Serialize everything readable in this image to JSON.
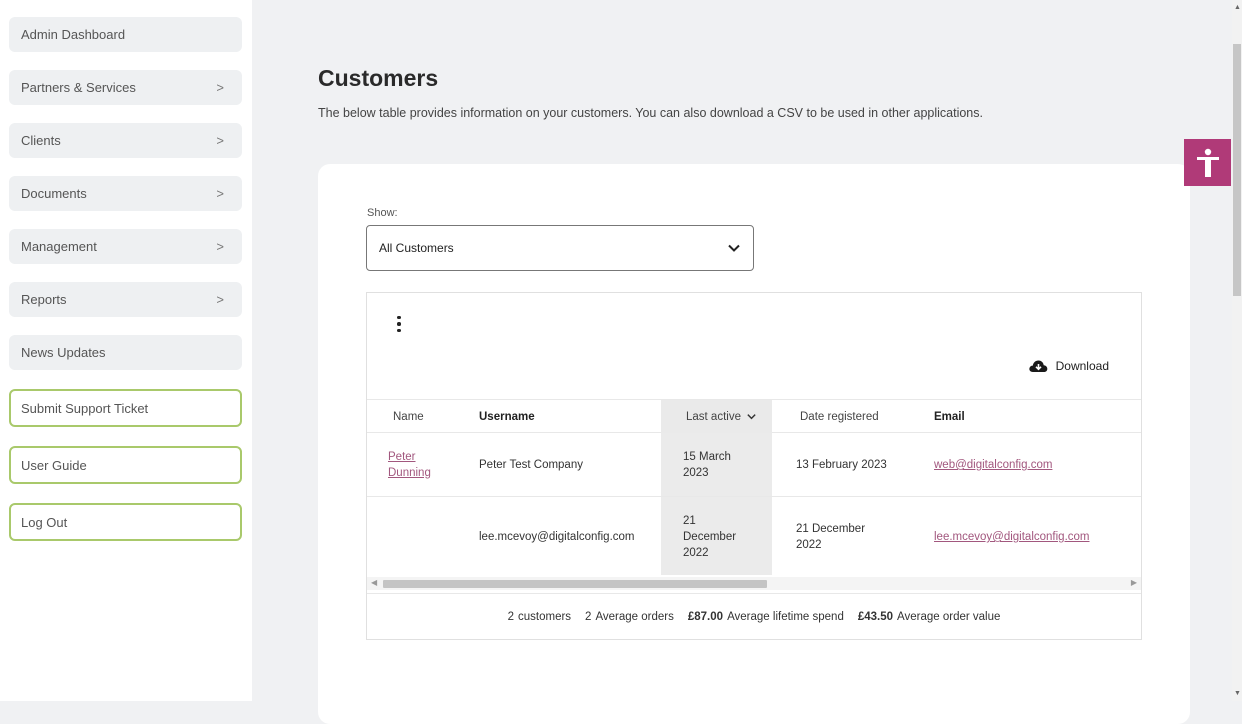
{
  "sidebar": {
    "items": [
      {
        "label": "Admin Dashboard"
      },
      {
        "label": "Partners & Services"
      },
      {
        "label": "Clients"
      },
      {
        "label": "Documents"
      },
      {
        "label": "Management"
      },
      {
        "label": "Reports"
      },
      {
        "label": "News Updates"
      },
      {
        "label": "Submit Support Ticket"
      },
      {
        "label": "User Guide"
      },
      {
        "label": "Log Out"
      }
    ],
    "chevron": ">"
  },
  "page": {
    "title": "Customers",
    "subtitle": "The below table provides information on your customers. You can also download a CSV to be used in other applications."
  },
  "filter": {
    "label": "Show:",
    "selected": "All Customers"
  },
  "toolbar": {
    "download_label": "Download"
  },
  "table": {
    "columns": [
      "Name",
      "Username",
      "Last active",
      "Date registered",
      "Email"
    ],
    "rows": [
      {
        "name": "Peter Dunning",
        "username": "Peter Test Company",
        "last_active": "15 March 2023",
        "date_registered": "13 February 2023",
        "email": "web@digitalconfig.com"
      },
      {
        "name": "",
        "username": "lee.mcevoy@digitalconfig.com",
        "last_active": "21 December 2022",
        "date_registered": "21 December 2022",
        "email": "lee.mcevoy@digitalconfig.com"
      }
    ]
  },
  "summary": {
    "customers_value": "2",
    "customers_label": "customers",
    "orders_value": "2",
    "orders_label": "Average orders",
    "lifetime_value": "£87.00",
    "lifetime_label": "Average lifetime spend",
    "order_value": "£43.50",
    "order_value_label": "Average order value"
  },
  "colors": {
    "accent": "#b03a78",
    "link": "#a2577e",
    "outline": "#a9c96b"
  }
}
